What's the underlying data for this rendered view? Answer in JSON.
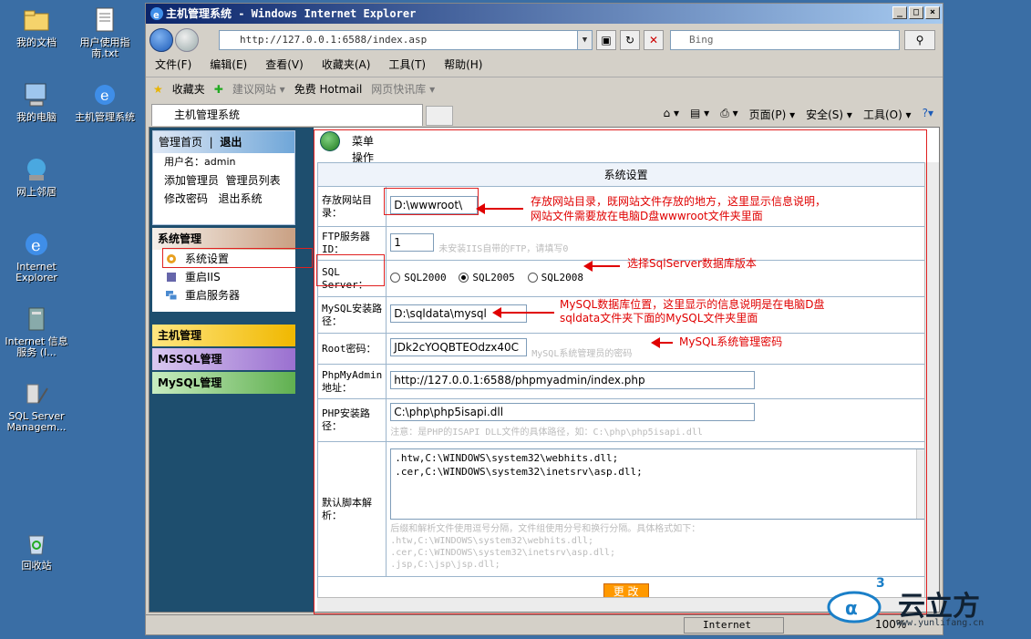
{
  "desktop": {
    "icons": [
      {
        "label": "我的文档"
      },
      {
        "label": "用户使用指南.txt"
      },
      {
        "label": "我的电脑"
      },
      {
        "label": "主机管理系统"
      },
      {
        "label": "网上邻居"
      },
      {
        "label": "Internet Explorer"
      },
      {
        "label": "Internet 信息服务 (I..."
      },
      {
        "label": "SQL Server Managem..."
      },
      {
        "label": "回收站"
      }
    ]
  },
  "browser": {
    "title": "主机管理系统 - Windows Internet Explorer",
    "address": "http://127.0.0.1:6588/index.asp",
    "search_placeholder": "Bing",
    "menu": [
      "文件(F)",
      "编辑(E)",
      "查看(V)",
      "收藏夹(A)",
      "工具(T)",
      "帮助(H)"
    ],
    "favorites": {
      "label": "收藏夹",
      "items": [
        "建议网站 ▾",
        "免费 Hotmail",
        "网页快讯库 ▾"
      ]
    },
    "tab_title": "主机管理系统",
    "commands": [
      "页面(P) ▾",
      "安全(S) ▾",
      "工具(O) ▾"
    ],
    "status_zone": "Internet",
    "zoom": "100%"
  },
  "sidebar": {
    "home": "管理首页",
    "logout": "退出",
    "username_label": "用户名：admin",
    "links": [
      "添加管理员",
      "管理员列表",
      "修改密码",
      "退出系统"
    ],
    "system_header": "系统管理",
    "system_items": [
      "系统设置",
      "重启IIS",
      "重启服务器"
    ],
    "sections": [
      "主机管理",
      "MSSQL管理",
      "MySQL管理"
    ]
  },
  "main": {
    "toolbar_label": "菜单操作",
    "table_title": "系统设置",
    "rows": {
      "site_dir": {
        "label": "存放网站目录：",
        "value": "D:\\wwwroot\\"
      },
      "ftp": {
        "label": "FTP服务器ID：",
        "value": "1",
        "hint": "未安装IIS自带的FTP，请填写0"
      },
      "sql": {
        "label": "SQL Server：",
        "options": [
          "SQL2000",
          "SQL2005",
          "SQL2008"
        ],
        "selected": "SQL2005"
      },
      "mysql_path": {
        "label": "MySQL安装路径：",
        "value": "D:\\sqldata\\mysql"
      },
      "root_pwd": {
        "label": "Root密码：",
        "value": "JDk2cYOQBTEOdzx40C",
        "hint": "MySQL系统管理员的密码"
      },
      "phpmyadmin": {
        "label": "PhpMyAdmin地址：",
        "value": "http://127.0.0.1:6588/phpmyadmin/index.php"
      },
      "php_path": {
        "label": "PHP安装路径：",
        "value": "C:\\php\\php5isapi.dll",
        "hint": "注意：是PHP的ISAPI DLL文件的具体路径，如：C:\\php\\php5isapi.dll"
      },
      "script_map": {
        "label": "默认脚本解析：",
        "lines": [
          ".htw,C:\\WINDOWS\\system32\\webhits.dll;",
          ".cer,C:\\WINDOWS\\system32\\inetsrv\\asp.dll;"
        ],
        "hint_lines": [
          "后缀和解析文件使用逗号分隔，文件组使用分号和换行分隔。具体格式如下：",
          ".htw,C:\\WINDOWS\\system32\\webhits.dll;",
          ".cer,C:\\WINDOWS\\system32\\inetsrv\\asp.dll;",
          ".jsp,C:\\jsp\\jsp.dll;"
        ]
      }
    },
    "submit_label": "更 改"
  },
  "annotations": {
    "site_dir_note_1": "存放网站目录，既网站文件存放的地方，这里显示信息说明，",
    "site_dir_note_2": "网站文件需要放在电脑D盘wwwroot文件夹里面",
    "sql_note": "选择SqlServer数据库版本",
    "mysql_note_1": "MySQL数据库位置，这里显示的信息说明是在电脑D盘",
    "mysql_note_2": "sqldata文件夹下面的MySQL文件夹里面",
    "root_note": "MySQL系统管理密码"
  },
  "watermark": {
    "brand": "云立方",
    "url": "www.yunlifang.cn",
    "superscript": "3"
  },
  "colors": {
    "desktop": "#3a6ea5",
    "annotation": "#e00000",
    "submit": "#ff9900",
    "sidebar": "#1e4e6e"
  }
}
